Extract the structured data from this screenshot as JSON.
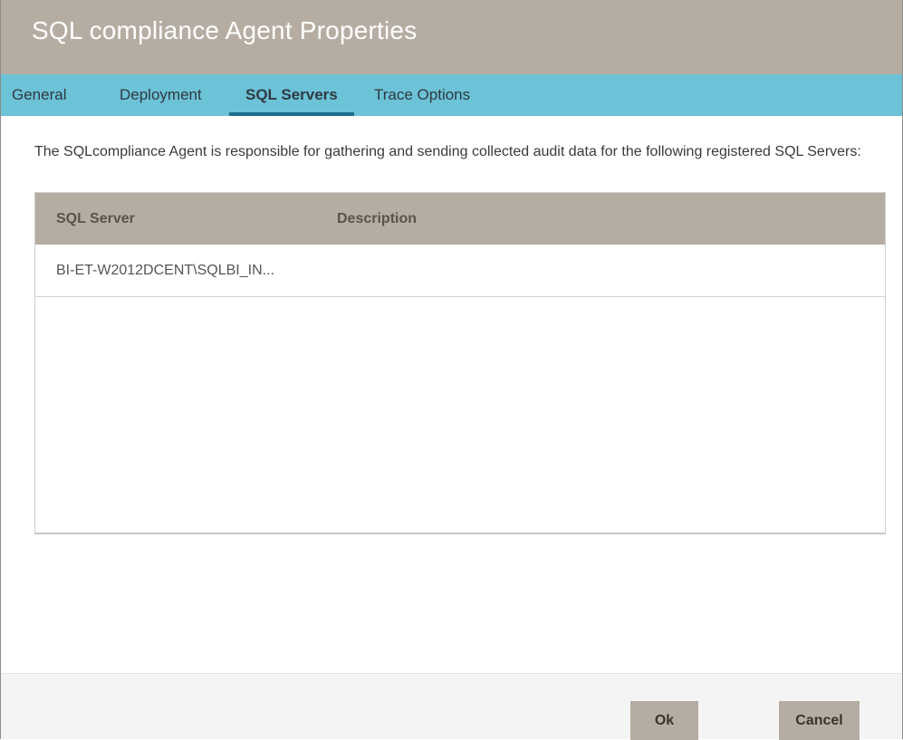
{
  "window": {
    "title": "SQL compliance Agent Properties"
  },
  "tabs": [
    {
      "label": "General",
      "active": false
    },
    {
      "label": "Deployment",
      "active": false
    },
    {
      "label": "SQL Servers",
      "active": true
    },
    {
      "label": "Trace Options",
      "active": false
    }
  ],
  "content": {
    "intro_text": "The SQLcompliance Agent is responsible for gathering and sending collected audit data for the following registered SQL Servers:"
  },
  "grid": {
    "columns": [
      "SQL Server",
      "Description"
    ],
    "rows": [
      {
        "server": "BI-ET-W2012DCENT\\SQLBI_IN...",
        "description": ""
      }
    ]
  },
  "footer": {
    "ok_label": "Ok",
    "cancel_label": "Cancel"
  },
  "colors": {
    "titlebar": "#b6ada2",
    "tabbar": "#6cc2d7",
    "tab_indicator": "#1a6d8c",
    "button": "#b6ada2"
  }
}
